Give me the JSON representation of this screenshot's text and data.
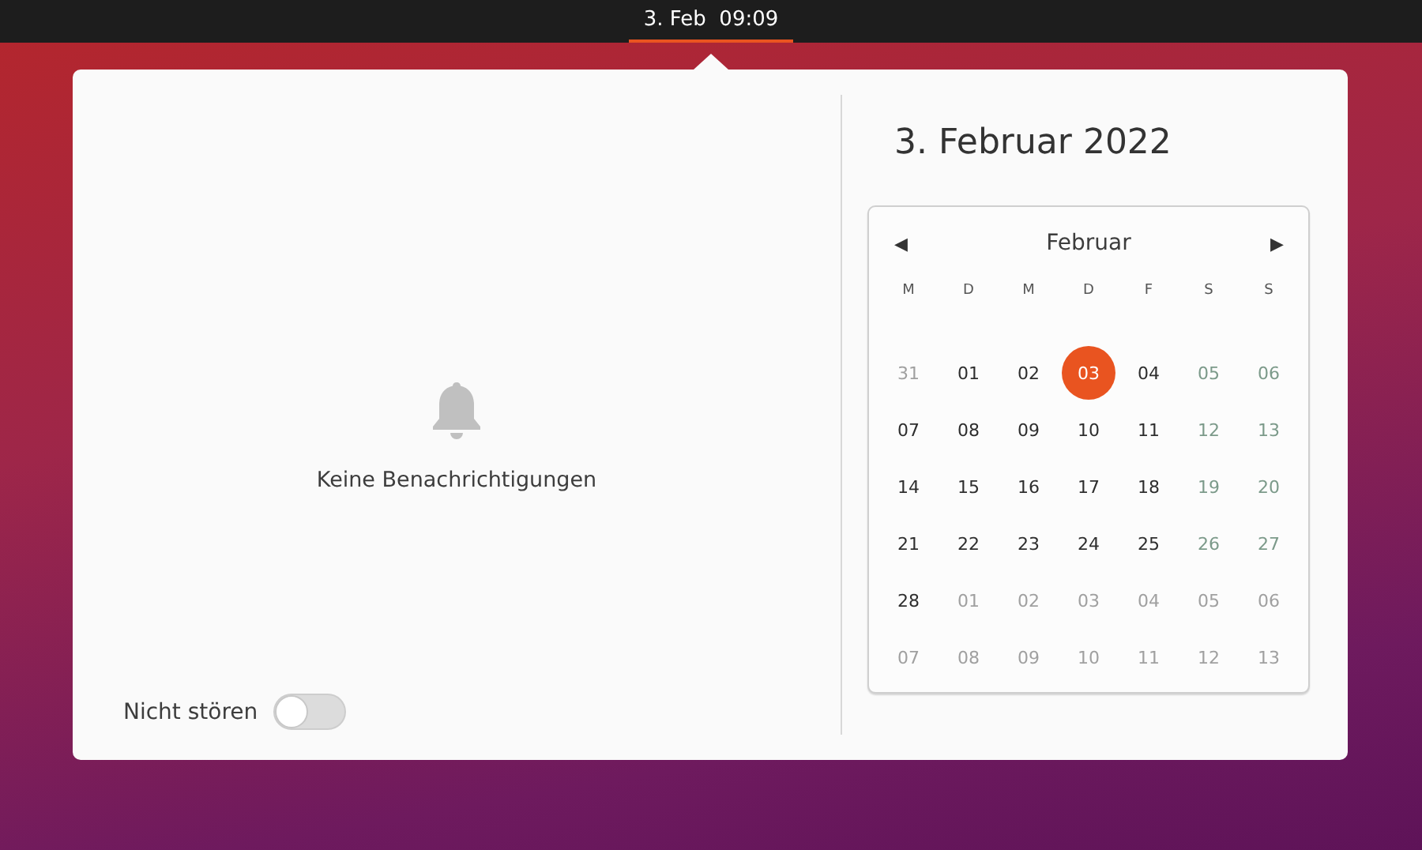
{
  "top_bar": {
    "clock": "3. Feb  09:09",
    "selected": true
  },
  "notifications": {
    "empty_text": "Keine Benachrichtigungen",
    "do_not_disturb": {
      "label": "Nicht stören",
      "on": false
    }
  },
  "calendar": {
    "date_title": "3. Februar 2022",
    "month": "Februar",
    "prev": "◀",
    "next": "▶",
    "weekdays": [
      "M",
      "D",
      "M",
      "D",
      "F",
      "S",
      "S"
    ],
    "weeks": [
      [
        {
          "day": "31",
          "kind": "outside",
          "selected": false
        },
        {
          "day": "01",
          "kind": "weekday",
          "selected": false
        },
        {
          "day": "02",
          "kind": "weekday",
          "selected": false
        },
        {
          "day": "03",
          "kind": "weekday",
          "selected": true
        },
        {
          "day": "04",
          "kind": "weekday",
          "selected": false
        },
        {
          "day": "05",
          "kind": "weekend",
          "selected": false
        },
        {
          "day": "06",
          "kind": "weekend",
          "selected": false
        }
      ],
      [
        {
          "day": "07",
          "kind": "weekday",
          "selected": false
        },
        {
          "day": "08",
          "kind": "weekday",
          "selected": false
        },
        {
          "day": "09",
          "kind": "weekday",
          "selected": false
        },
        {
          "day": "10",
          "kind": "weekday",
          "selected": false
        },
        {
          "day": "11",
          "kind": "weekday",
          "selected": false
        },
        {
          "day": "12",
          "kind": "weekend",
          "selected": false
        },
        {
          "day": "13",
          "kind": "weekend",
          "selected": false
        }
      ],
      [
        {
          "day": "14",
          "kind": "weekday",
          "selected": false
        },
        {
          "day": "15",
          "kind": "weekday",
          "selected": false
        },
        {
          "day": "16",
          "kind": "weekday",
          "selected": false
        },
        {
          "day": "17",
          "kind": "weekday",
          "selected": false
        },
        {
          "day": "18",
          "kind": "weekday",
          "selected": false
        },
        {
          "day": "19",
          "kind": "weekend",
          "selected": false
        },
        {
          "day": "20",
          "kind": "weekend",
          "selected": false
        }
      ],
      [
        {
          "day": "21",
          "kind": "weekday",
          "selected": false
        },
        {
          "day": "22",
          "kind": "weekday",
          "selected": false
        },
        {
          "day": "23",
          "kind": "weekday",
          "selected": false
        },
        {
          "day": "24",
          "kind": "weekday",
          "selected": false
        },
        {
          "day": "25",
          "kind": "weekday",
          "selected": false
        },
        {
          "day": "26",
          "kind": "weekend",
          "selected": false
        },
        {
          "day": "27",
          "kind": "weekend",
          "selected": false
        }
      ],
      [
        {
          "day": "28",
          "kind": "weekday",
          "selected": false
        },
        {
          "day": "01",
          "kind": "outside",
          "selected": false
        },
        {
          "day": "02",
          "kind": "outside",
          "selected": false
        },
        {
          "day": "03",
          "kind": "outside",
          "selected": false
        },
        {
          "day": "04",
          "kind": "outside",
          "selected": false
        },
        {
          "day": "05",
          "kind": "outside",
          "selected": false
        },
        {
          "day": "06",
          "kind": "outside",
          "selected": false
        }
      ],
      [
        {
          "day": "07",
          "kind": "outside",
          "selected": false
        },
        {
          "day": "08",
          "kind": "outside",
          "selected": false
        },
        {
          "day": "09",
          "kind": "outside",
          "selected": false
        },
        {
          "day": "10",
          "kind": "outside",
          "selected": false
        },
        {
          "day": "11",
          "kind": "outside",
          "selected": false
        },
        {
          "day": "12",
          "kind": "outside",
          "selected": false
        },
        {
          "day": "13",
          "kind": "outside",
          "selected": false
        }
      ]
    ]
  }
}
